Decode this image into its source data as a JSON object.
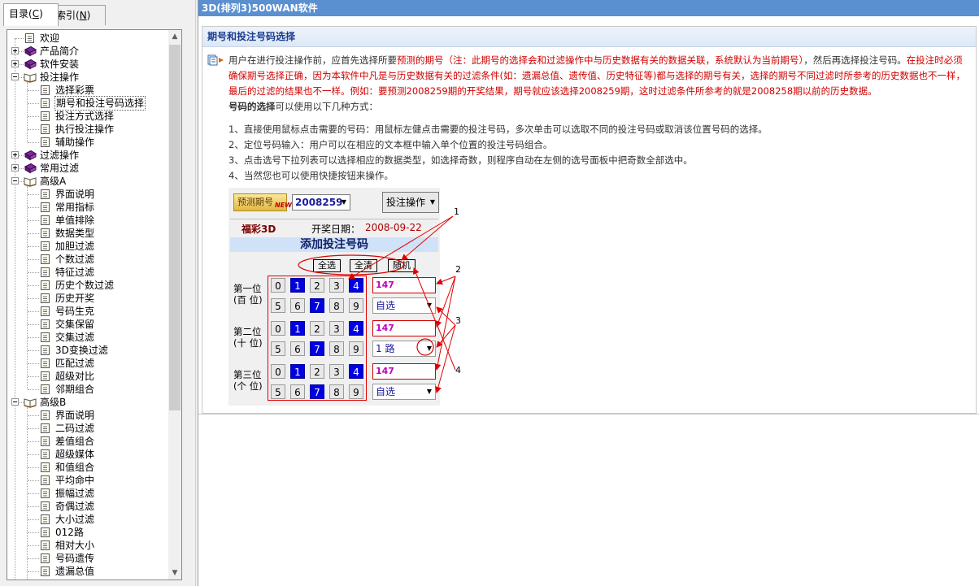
{
  "left_pane": {
    "tabs": [
      {
        "label_main": "目录(",
        "label_key": "C",
        "label_end": ")"
      },
      {
        "label_main": "索引(",
        "label_key": "N",
        "label_end": ")"
      }
    ],
    "tree": [
      {
        "label": "欢迎"
      },
      {
        "label": "产品简介"
      },
      {
        "label": "软件安装"
      },
      {
        "label": "投注操作"
      },
      {
        "label": "选择彩票"
      },
      {
        "label": "期号和投注号码选择"
      },
      {
        "label": "投注方式选择"
      },
      {
        "label": "执行投注操作"
      },
      {
        "label": "辅助操作"
      },
      {
        "label": "过滤操作"
      },
      {
        "label": "常用过滤"
      },
      {
        "label": "高级A"
      },
      {
        "label": "界面说明"
      },
      {
        "label": "常用指标"
      },
      {
        "label": "单值排除"
      },
      {
        "label": "数据类型"
      },
      {
        "label": "加胆过滤"
      },
      {
        "label": "个数过滤"
      },
      {
        "label": "特征过滤"
      },
      {
        "label": "历史个数过滤"
      },
      {
        "label": "历史开奖"
      },
      {
        "label": "号码生克"
      },
      {
        "label": "交集保留"
      },
      {
        "label": "交集过滤"
      },
      {
        "label": "3D变换过滤"
      },
      {
        "label": "匹配过滤"
      },
      {
        "label": "超级对比"
      },
      {
        "label": "邻期组合"
      },
      {
        "label": "高级B"
      },
      {
        "label": "界面说明"
      },
      {
        "label": "二码过滤"
      },
      {
        "label": "差值组合"
      },
      {
        "label": "超级媒体"
      },
      {
        "label": "和值组合"
      },
      {
        "label": "平均命中"
      },
      {
        "label": "振幅过滤"
      },
      {
        "label": "奇偶过滤"
      },
      {
        "label": "大小过滤"
      },
      {
        "label": "012路"
      },
      {
        "label": "相对大小"
      },
      {
        "label": "号码遗传"
      },
      {
        "label": "遗漏总值"
      }
    ]
  },
  "content": {
    "window_title": "3D(排列3)500WAN软件",
    "section_title": "期号和投注号码选择",
    "para1": {
      "t1": "用户在进行投注操作前，应首先选择所要",
      "t2": "预测的期号（注：此期号的选择会和过滤操作中与历史数据有关的数据关联，系统默认为当前期号）",
      "t3": "，然后再选择投注号码。",
      "t4": "在投注时必须确保期号选择正确，因为本软件中凡是与历史数据有关的过滤条件(如：遗漏总值、遗传值、历史特征等)都与选择的期号有关，选择的期号不同过滤时所参考的历史数据也不一样，最后的过滤的结果也不一样。例如：要预测2008259期的开奖结果，期号就应该选择2008259期，这时过滤条件所参考的就是2008258期以前的历史数据。"
    },
    "para2": {
      "bold": "号码的选择",
      "rest": "可以使用以下几种方式："
    },
    "list": [
      "1、直接使用鼠标点击需要的号码：用鼠标左健点击需要的投注号码，多次单击可以选取不同的投注号码或取消该位置号码的选择。",
      "2、定位号码输入：用户可以在相应的文本框中输入单个位置的投注号码组合。",
      "3、点击选号下拉列表可以选择相应的数据类型，如选择奇数，则程序自动在左侧的选号面板中把奇数全部选中。",
      "4、当然您也可以使用快捷按钮来操作。"
    ],
    "mini": {
      "predict_label": "预测期号",
      "new_tag": "NEW!",
      "period_value": "2008259",
      "bet_button": "投注操作",
      "lottery_name": "福彩3D",
      "draw_label": "开奖日期：",
      "draw_date": "2008-09-22",
      "add_title": "添加投注号码",
      "buttons": {
        "select_all": "全选",
        "clear_all": "全清",
        "random": "随机"
      },
      "positions": [
        {
          "line1": "第一位",
          "line2": "(百 位)",
          "input": "147",
          "select": "自选"
        },
        {
          "line1": "第二位",
          "line2": "(十 位)",
          "input": "147",
          "select": "1 路"
        },
        {
          "line1": "第三位",
          "line2": "(个 位)",
          "input": "147",
          "select": "自选"
        }
      ],
      "digits_row1": [
        "0",
        "1",
        "2",
        "3",
        "4"
      ],
      "digits_row2": [
        "5",
        "6",
        "7",
        "8",
        "9"
      ],
      "selected_digits": [
        1,
        4,
        7
      ]
    },
    "annotations": [
      "1",
      "2",
      "3",
      "4"
    ]
  }
}
